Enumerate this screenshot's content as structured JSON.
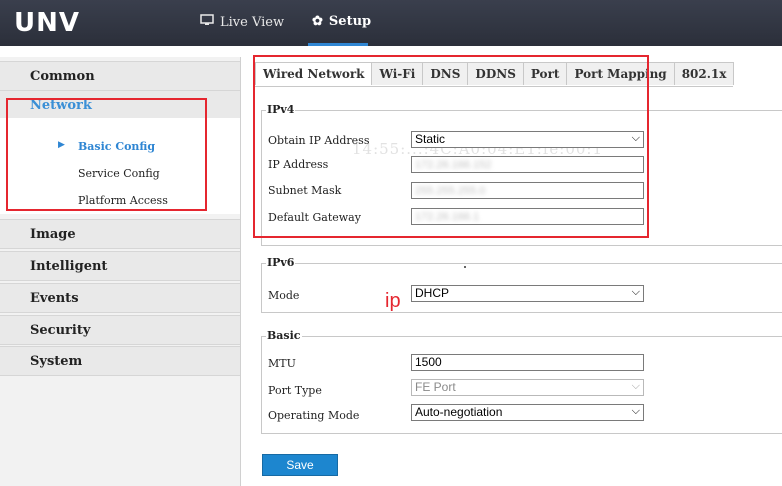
{
  "topbar": {
    "logo": "UNV",
    "nav": [
      {
        "label": "Live View",
        "icon": "monitor-icon"
      },
      {
        "label": "Setup",
        "icon": "gear-icon"
      }
    ]
  },
  "sidebar": {
    "items": [
      {
        "label": "Common"
      },
      {
        "label": "Network",
        "active": true
      },
      {
        "label": "Image"
      },
      {
        "label": "Intelligent"
      },
      {
        "label": "Events"
      },
      {
        "label": "Security"
      },
      {
        "label": "System"
      }
    ],
    "network_sub": [
      {
        "label": "Basic Config",
        "active": true
      },
      {
        "label": "Service Config"
      },
      {
        "label": "Platform Access"
      }
    ]
  },
  "tabs": [
    {
      "label": "Wired Network",
      "active": true
    },
    {
      "label": "Wi-Fi"
    },
    {
      "label": "DNS"
    },
    {
      "label": "DDNS"
    },
    {
      "label": "Port"
    },
    {
      "label": "Port Mapping"
    },
    {
      "label": "802.1x"
    }
  ],
  "ipv4": {
    "legend": "IPv4",
    "obtain_label": "Obtain IP Address",
    "obtain_value": "Static",
    "ip_label": "IP Address",
    "ip_value": "172.26.166.152",
    "mask_label": "Subnet Mask",
    "mask_value": "255.255.255.0",
    "gw_label": "Default Gateway",
    "gw_value": "172.26.166.1"
  },
  "mac_ghost": "14:55:...:4C:A0:04:E1:fe:00:1",
  "ipv6": {
    "legend": "IPv6",
    "mode_label": "Mode",
    "mode_value": "DHCP"
  },
  "annotation": {
    "ip_text": "ip",
    "color": "#e5262f"
  },
  "basic": {
    "legend": "Basic",
    "mtu_label": "MTU",
    "mtu_value": "1500",
    "port_type_label": "Port Type",
    "port_type_value": "FE Port",
    "op_mode_label": "Operating Mode",
    "op_mode_value": "Auto-negotiation"
  },
  "save_label": "Save",
  "colors": {
    "accent": "#1d86cf",
    "topbar": "#2f333e"
  }
}
